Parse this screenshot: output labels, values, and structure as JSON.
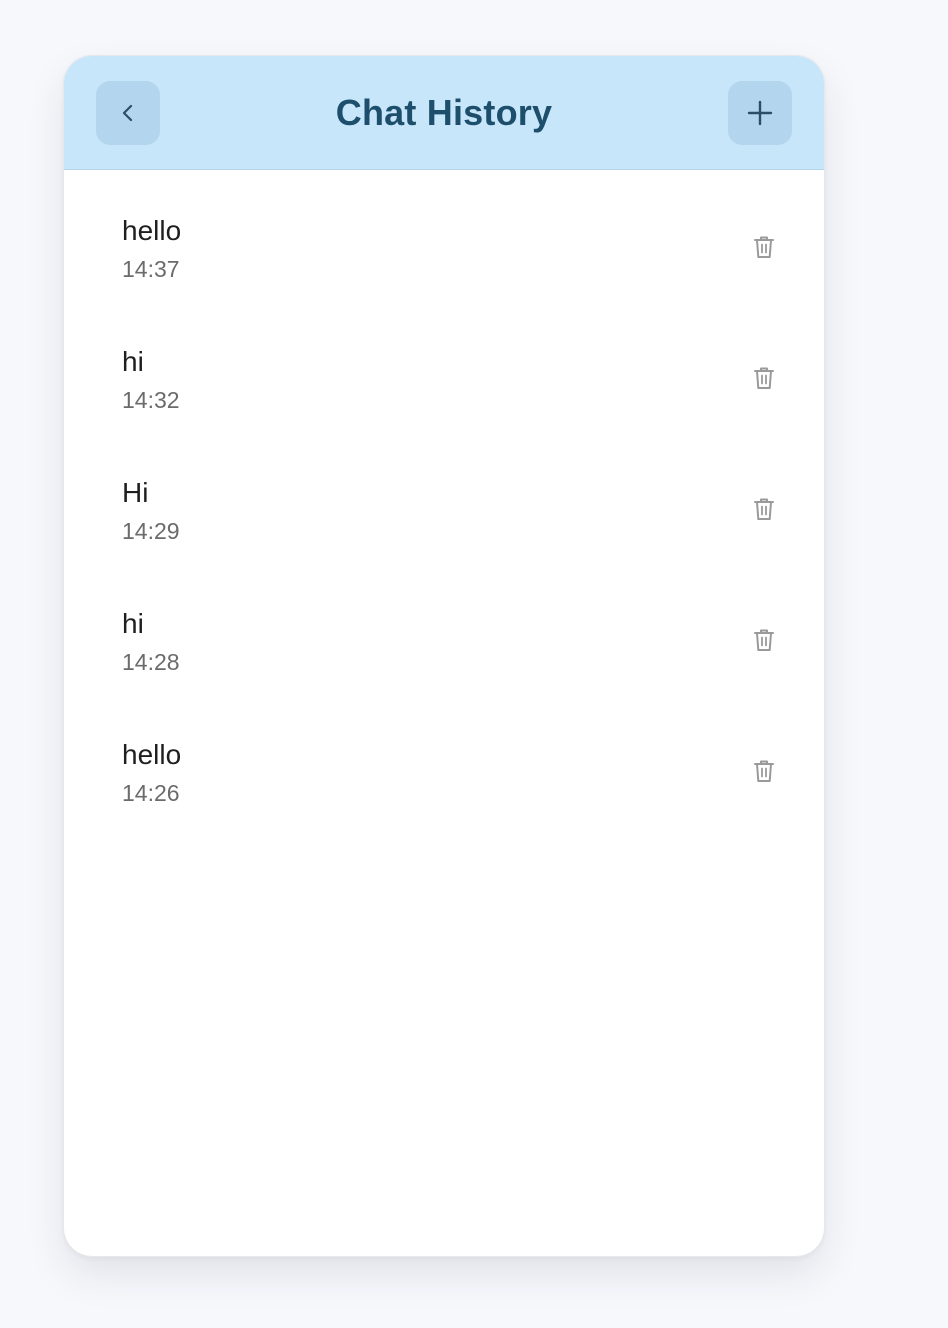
{
  "header": {
    "title": "Chat History",
    "back_icon": "chevron-left-icon",
    "add_icon": "plus-icon"
  },
  "conversations": [
    {
      "title": "hello",
      "time": "14:37"
    },
    {
      "title": "hi",
      "time": "14:32"
    },
    {
      "title": "Hi",
      "time": "14:29"
    },
    {
      "title": "hi",
      "time": "14:28"
    },
    {
      "title": "hello",
      "time": "14:26"
    }
  ],
  "colors": {
    "header_bg": "#c8e6fa",
    "header_button_bg": "#b3d6ee",
    "title": "#1d4e6b",
    "timestamp": "#6b6b6b",
    "trash_icon": "#9a9a9a"
  }
}
